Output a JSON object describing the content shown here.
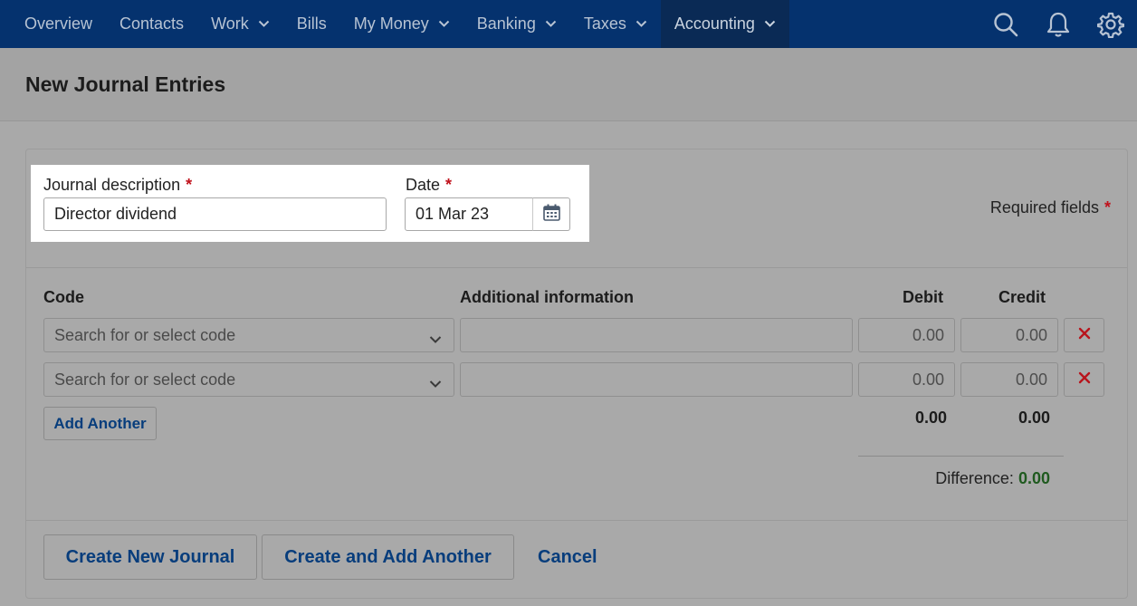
{
  "nav": {
    "items": [
      {
        "label": "Overview",
        "dropdown": false
      },
      {
        "label": "Contacts",
        "dropdown": false
      },
      {
        "label": "Work",
        "dropdown": true
      },
      {
        "label": "Bills",
        "dropdown": false
      },
      {
        "label": "My Money",
        "dropdown": true
      },
      {
        "label": "Banking",
        "dropdown": true
      },
      {
        "label": "Taxes",
        "dropdown": true
      },
      {
        "label": "Accounting",
        "dropdown": true,
        "active": true
      }
    ],
    "icons": [
      "search-icon",
      "bell-icon",
      "gear-icon"
    ]
  },
  "page": {
    "title": "New Journal Entries"
  },
  "form": {
    "description_label": "Journal description",
    "description_value": "Director dividend",
    "date_label": "Date",
    "date_value": "01 Mar 23",
    "required_star": "*",
    "required_note": "Required fields"
  },
  "table": {
    "headers": {
      "code": "Code",
      "info": "Additional information",
      "debit": "Debit",
      "credit": "Credit"
    },
    "rows": [
      {
        "code_placeholder": "Search for or select code",
        "info": "",
        "debit": "0.00",
        "credit": "0.00"
      },
      {
        "code_placeholder": "Search for or select code",
        "info": "",
        "debit": "0.00",
        "credit": "0.00"
      }
    ],
    "add_another": "Add Another",
    "total_debit": "0.00",
    "total_credit": "0.00",
    "difference_label": "Difference:",
    "difference_value": "0.00"
  },
  "actions": {
    "create": "Create New Journal",
    "create_add": "Create and Add Another",
    "cancel": "Cancel"
  },
  "colors": {
    "nav_bg": "#05326e",
    "nav_active_bg": "#0a2a55",
    "link_blue": "#073d7c",
    "required_red": "#c0121c",
    "difference_green": "#1f5a1f",
    "overlay_gray": "#a9a9a9"
  }
}
